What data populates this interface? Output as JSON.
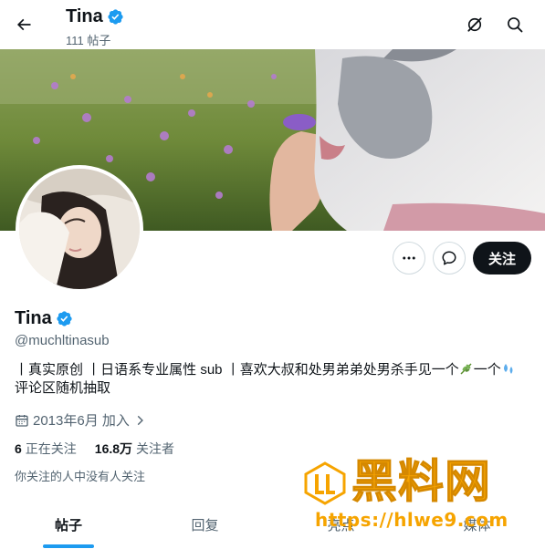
{
  "header": {
    "title": "Tina",
    "subtitle": "111 帖子",
    "icons": [
      "back-arrow-icon",
      "verified-badge-icon",
      "grok-icon",
      "search-icon"
    ]
  },
  "profile": {
    "name": "Tina",
    "handle": "@muchltinasub",
    "bio_line1_prefix": "丨真实原创 丨日语系专业属性 sub 丨喜欢大叔和处男弟弟处男杀手见一个",
    "bio_line1_mid": "一个",
    "bio_line2": "评论区随机抽取",
    "bio_emojis": [
      "herb-emoji",
      "sweat-droplets-emoji"
    ],
    "joined": "2013年6月 加入",
    "following_count": "6",
    "following_label": "正在关注",
    "followers_count": "16.8万",
    "followers_label": "关注者",
    "mutual_text": "你关注的人中没有人关注"
  },
  "actions": {
    "more_icon": "more-icon",
    "message_icon": "message-icon",
    "follow_label": "关注"
  },
  "tabs": [
    {
      "label": "帖子",
      "active": true
    },
    {
      "label": "回复",
      "active": false
    },
    {
      "label": "亮点",
      "active": false
    },
    {
      "label": "媒体",
      "active": false
    }
  ],
  "watermark": {
    "text": "黑料网",
    "url": "https://hlwe9.com"
  },
  "colors": {
    "accent": "#1d9bf0",
    "follow_button": "#0f1419",
    "watermark": "#f6a400"
  }
}
